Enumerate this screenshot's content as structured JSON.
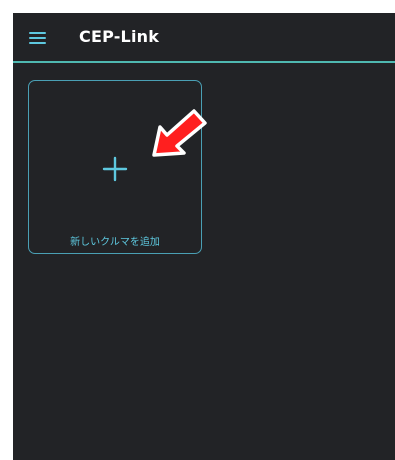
{
  "appbar": {
    "title": "CEP-Link",
    "menu_icon": "hamburger-menu-icon"
  },
  "main": {
    "add_card": {
      "label": "新しいクルマを追加",
      "icon": "plus-icon"
    }
  },
  "annotation": {
    "icon": "red-arrow-icon"
  },
  "colors": {
    "background": "#222326",
    "accent": "#5ec8df",
    "divider": "#4fb8b1",
    "card_border": "#4a9fb4",
    "arrow_fill": "#ff1f1f",
    "arrow_stroke": "#ffffff"
  }
}
